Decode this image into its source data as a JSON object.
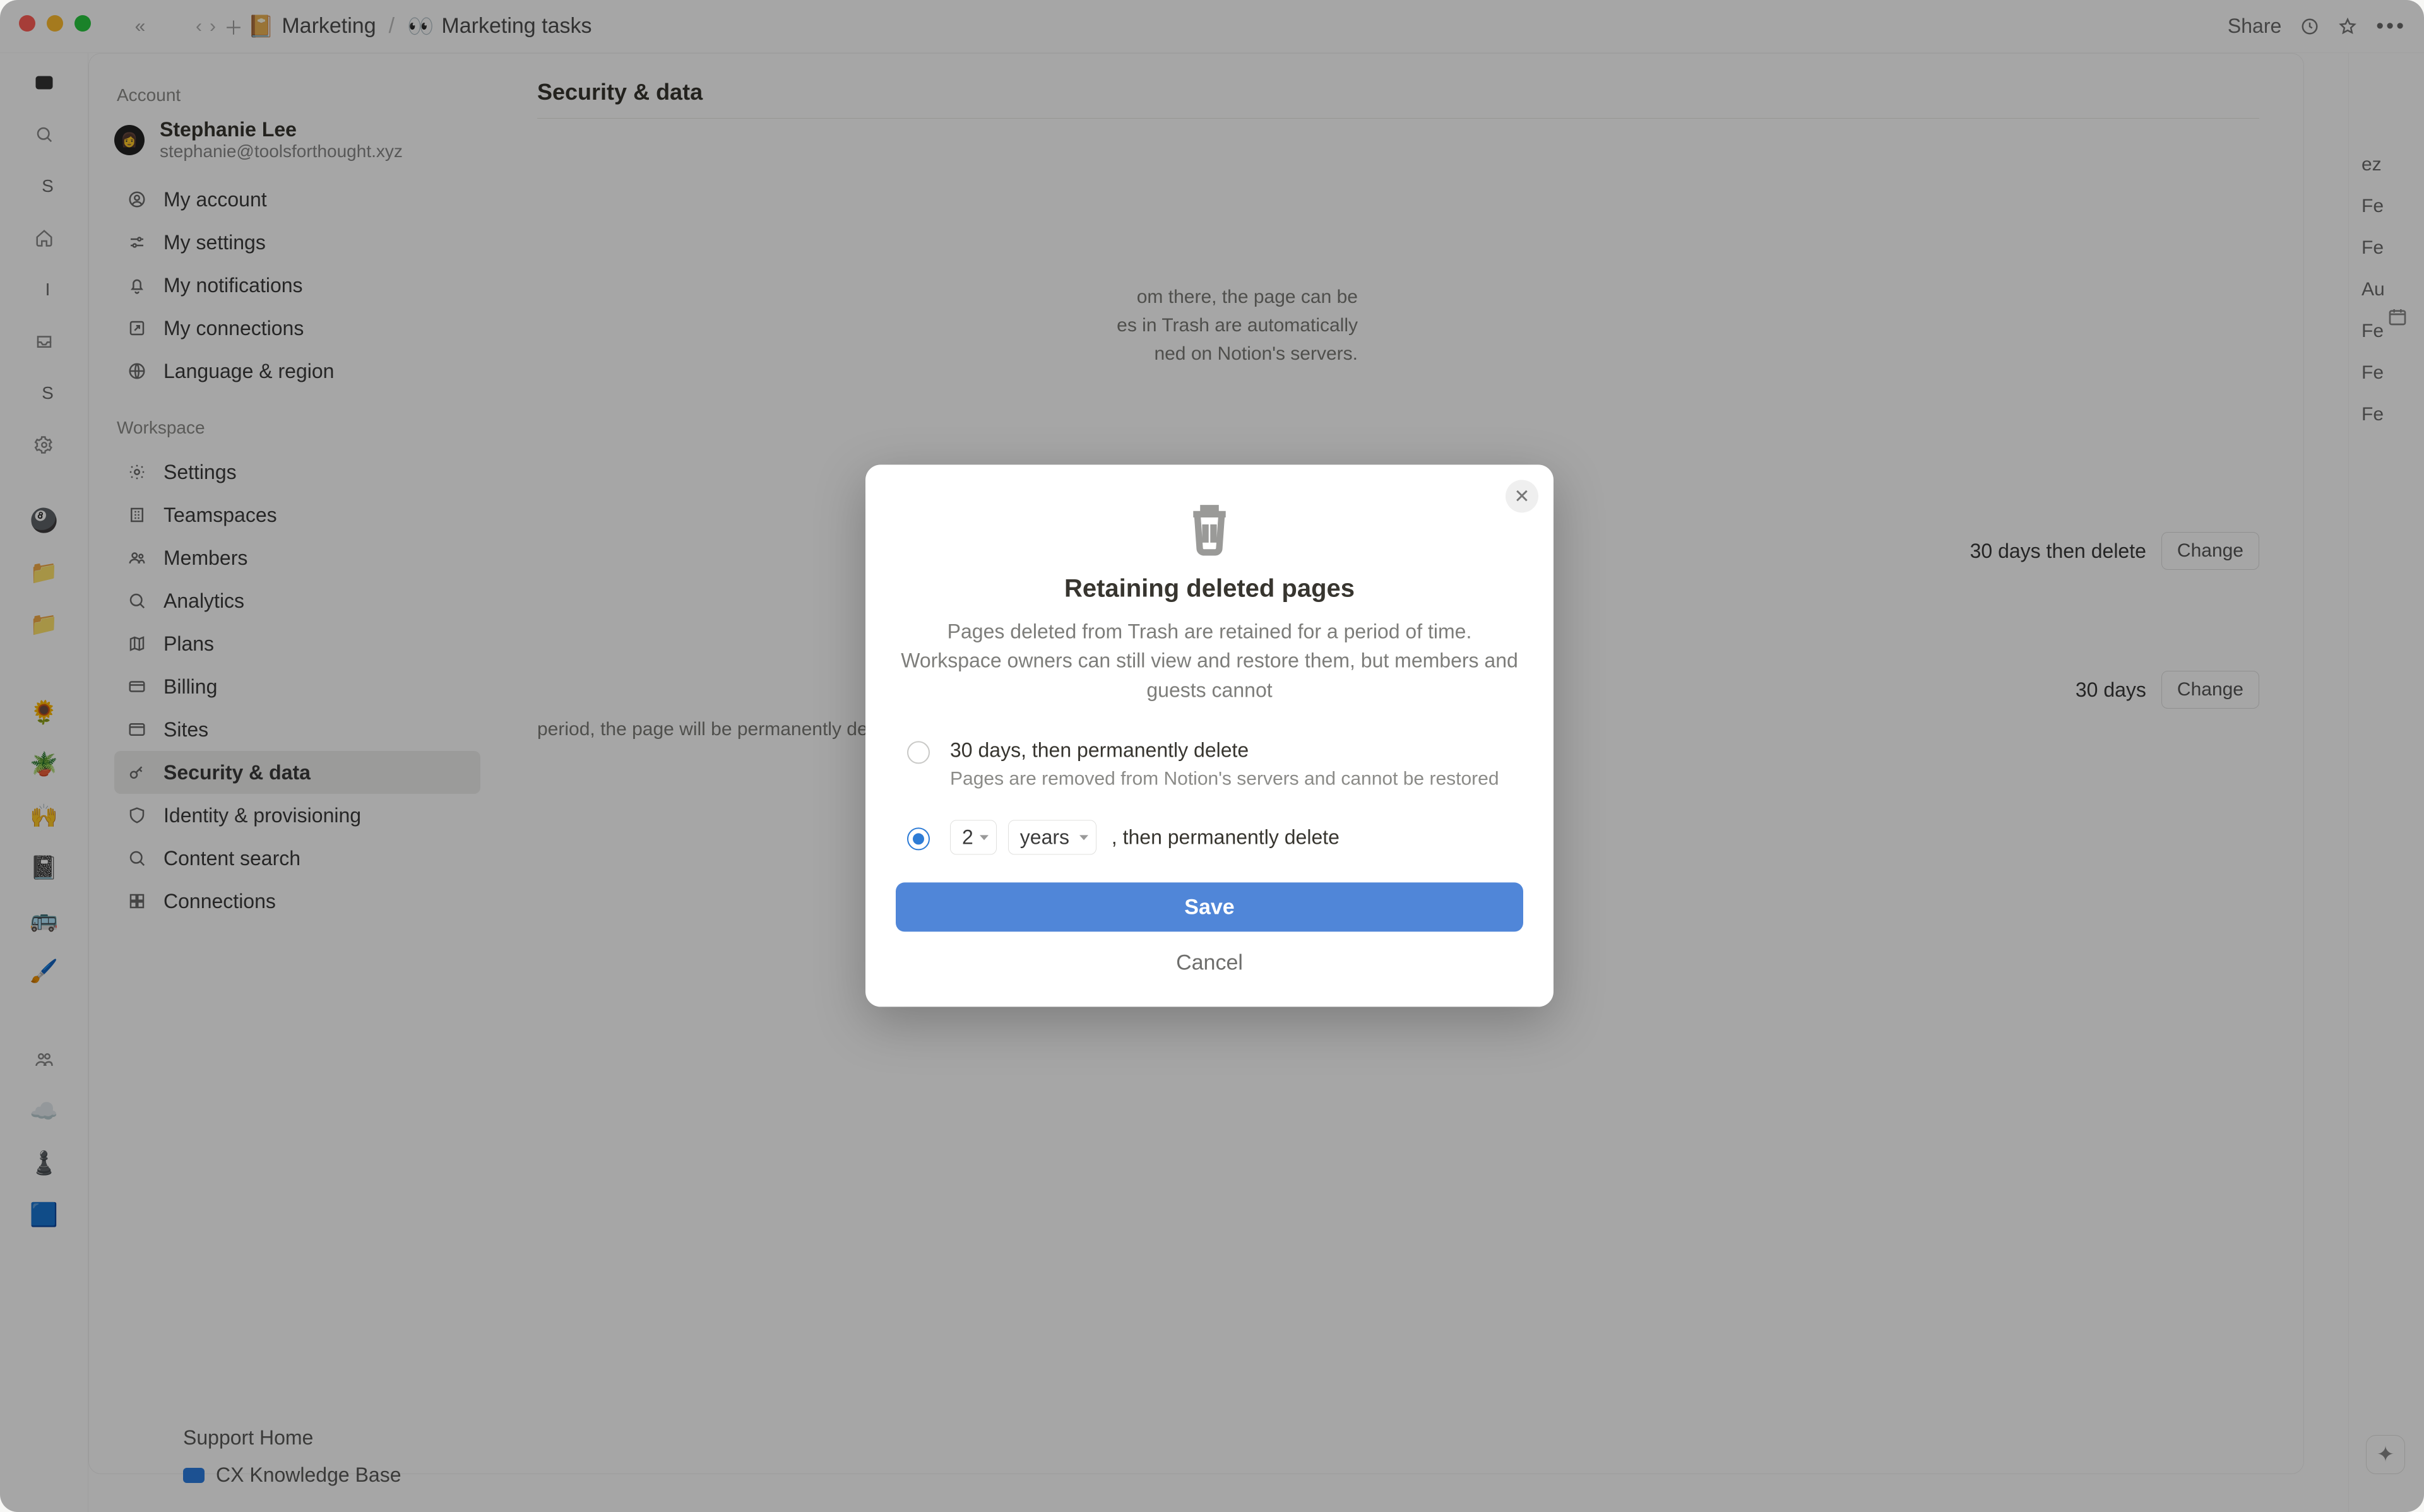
{
  "topbar": {
    "share": "Share",
    "breadcrumb": [
      "Marketing",
      "Marketing tasks"
    ],
    "breadcrumb_icons": [
      "📔",
      "👀"
    ]
  },
  "leftrail": {
    "letters": [
      "S",
      "I",
      "S"
    ]
  },
  "rightstrip": {
    "items": [
      "ez",
      "Fe",
      "Fe",
      "Au",
      "Fe",
      "Fe",
      "Fe"
    ]
  },
  "support": {
    "home": "Support Home",
    "kb": "CX Knowledge Base"
  },
  "settings": {
    "account_header": "Account",
    "workspace_header": "Workspace",
    "profile": {
      "name": "Stephanie Lee",
      "email": "stephanie@toolsforthought.xyz"
    },
    "account_items": [
      "My account",
      "My settings",
      "My notifications",
      "My connections",
      "Language & region"
    ],
    "workspace_items": [
      "Settings",
      "Teamspaces",
      "Members",
      "Analytics",
      "Plans",
      "Billing",
      "Sites",
      "Security & data",
      "Identity & provisioning",
      "Content search",
      "Connections"
    ],
    "active": "Security & data",
    "main": {
      "title": "Security & data",
      "desc_fragment_1": "om there, the page can be",
      "desc_fragment_2": "es in Trash are automatically",
      "desc_fragment_3": "ned on Notion's servers.",
      "retain_value": "30 days then delete",
      "change": "Change",
      "second_value": "30 days",
      "second_desc": "period, the page will be permanently deleted from Notion's servers"
    }
  },
  "modal": {
    "title": "Retaining deleted pages",
    "subtitle": "Pages deleted from Trash are retained for a period of time. Workspace owners can still view and restore them, but members and guests cannot",
    "opt1_title": "30 days, then permanently delete",
    "opt1_sub": "Pages are removed from Notion's servers and cannot be restored",
    "opt2_num": "2",
    "opt2_unit": "years",
    "opt2_tail": ", then permanently delete",
    "save": "Save",
    "cancel": "Cancel"
  }
}
